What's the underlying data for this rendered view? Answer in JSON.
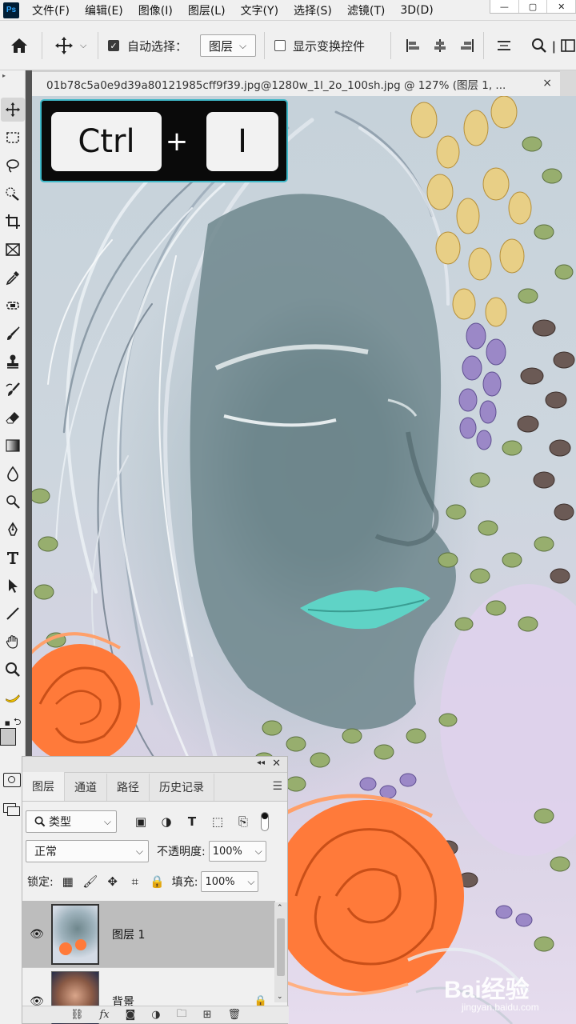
{
  "app": {
    "logo_text": "Ps"
  },
  "menubar": {
    "items": [
      "文件(F)",
      "编辑(E)",
      "图像(I)",
      "图层(L)",
      "文字(Y)",
      "选择(S)",
      "滤镜(T)",
      "3D(D)"
    ]
  },
  "window_controls": {
    "minimize": "—",
    "maximize": "▢",
    "close": "✕"
  },
  "options_bar": {
    "auto_select_label": "自动选择：",
    "auto_select_checked": true,
    "auto_select_target": "图层",
    "show_transform_label": "显示变换控件",
    "show_transform_checked": false
  },
  "document": {
    "tab_title": "01b78c5a0e9d39a80121985cff9f39.jpg@1280w_1l_2o_100sh.jpg @ 127% (图层 1, ...",
    "close_glyph": "×"
  },
  "shortcut_overlay": {
    "key1": "Ctrl",
    "plus": "+",
    "key2": "I"
  },
  "layers_panel": {
    "collapse_glyph": "◂◂",
    "close_glyph": "✕",
    "tabs": [
      "图层",
      "通道",
      "路径",
      "历史记录"
    ],
    "active_tab": "图层",
    "filter_label": "类型",
    "blend_mode": "正常",
    "opacity_label": "不透明度:",
    "opacity_value": "100%",
    "lock_label": "锁定:",
    "fill_label": "填充:",
    "fill_value": "100%",
    "layers": [
      {
        "name": "图层 1",
        "visible": true,
        "selected": true,
        "locked": false
      },
      {
        "name": "背景",
        "visible": true,
        "selected": false,
        "locked": true
      }
    ]
  },
  "watermark": {
    "logo": "Bai经验",
    "sub": "jingyan.baidu.com"
  },
  "colors": {
    "accent_border": "#3fb8c8",
    "lips": "#5fd3c6",
    "rose": "#ff7a3a",
    "leaves": "#8ea86a"
  }
}
